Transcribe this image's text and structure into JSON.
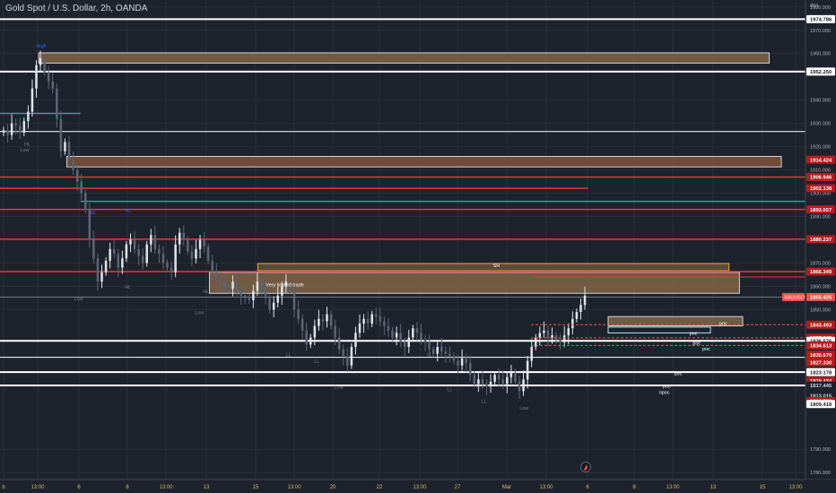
{
  "chart_data": {
    "type": "candlestick",
    "title": "Gold Spot / U.S. Dollar, 2h, OANDA",
    "symbol": "XAUUSD",
    "ylim": [
      1777,
      1983
    ],
    "x_ticks": [
      "b",
      "13:00",
      "6",
      "8",
      "13:00",
      "13",
      "15",
      "13:00",
      "20",
      "22",
      "13:00",
      "27",
      "Mar",
      "13:00",
      "6",
      "8",
      "13:00",
      "13",
      "15",
      "13:00"
    ],
    "y_ticks": [
      {
        "label": "1980.000",
        "value": 1980
      },
      {
        "label": "1970.000",
        "value": 1970
      },
      {
        "label": "1960.000",
        "value": 1960
      },
      {
        "label": "1940.000",
        "value": 1940
      },
      {
        "label": "1930.000",
        "value": 1930
      },
      {
        "label": "1920.000",
        "value": 1920
      },
      {
        "label": "1910.000",
        "value": 1910
      },
      {
        "label": "1900.000",
        "value": 1900
      },
      {
        "label": "1890.000",
        "value": 1890
      },
      {
        "label": "1870.000",
        "value": 1870
      },
      {
        "label": "1860.000",
        "value": 1860
      },
      {
        "label": "1850.000",
        "value": 1850
      },
      {
        "label": "1790.000",
        "value": 1790
      },
      {
        "label": "1780.000",
        "value": 1780
      }
    ],
    "price_labels": [
      {
        "value": 1974.786,
        "text": "1974.786",
        "bg": "#ffffff",
        "fg": "#131722"
      },
      {
        "value": 1952.25,
        "text": "1952.250",
        "bg": "#ffffff",
        "fg": "#131722"
      },
      {
        "value": 1914.424,
        "text": "1914.424",
        "bg": "#b71c1c",
        "fg": "#ffffff"
      },
      {
        "value": 1906.946,
        "text": "1906.946",
        "bg": "#b71c1c",
        "fg": "#ffffff"
      },
      {
        "value": 1902.138,
        "text": "1902.138",
        "bg": "#b71c1c",
        "fg": "#ffffff"
      },
      {
        "value": 1893.057,
        "text": "1893.057",
        "bg": "#b71c1c",
        "fg": "#ffffff"
      },
      {
        "value": 1880.237,
        "text": "1880.237",
        "bg": "#b71c1c",
        "fg": "#ffffff"
      },
      {
        "value": 1866.349,
        "text": "1866.349",
        "bg": "#b71c1c",
        "fg": "#ffffff"
      },
      {
        "value": 1855.425,
        "text": "1855.425",
        "bg": "#ef5350",
        "fg": "#ffffff",
        "tag": "XAUUSD"
      },
      {
        "value": 1843.493,
        "text": "1843.493",
        "bg": "#b71c1c",
        "fg": "#ffffff"
      },
      {
        "value": 1837.94,
        "text": "1837.940",
        "bg": "#b71c1c",
        "fg": "#ffffff"
      },
      {
        "value": 1836.576,
        "text": "1836.576",
        "bg": "#ffffff",
        "fg": "#131722"
      },
      {
        "value": 1834.613,
        "text": "1834.613",
        "bg": "#b71c1c",
        "fg": "#ffffff"
      },
      {
        "value": 1830.67,
        "text": "1830.670",
        "bg": "#b71c1c",
        "fg": "#ffffff"
      },
      {
        "value": 1827.33,
        "text": "1827.330",
        "bg": "#b71c1c",
        "fg": "#ffffff"
      },
      {
        "value": 1823.178,
        "text": "1823.178",
        "bg": "#ffffff",
        "fg": "#131722"
      },
      {
        "value": 1819.434,
        "text": "1819.434",
        "bg": "#b71c1c",
        "fg": "#ffffff"
      },
      {
        "value": 1817.445,
        "text": "1817.445",
        "bg": "#1e222d",
        "fg": "#d1d4dc"
      },
      {
        "value": 1813.015,
        "text": "1813.015",
        "bg": "#1e222d",
        "fg": "#d1d4dc"
      },
      {
        "value": 1810.739,
        "text": "1810.739",
        "bg": "#b71c1c",
        "fg": "#ffffff"
      },
      {
        "value": 1809.418,
        "text": "1809.418",
        "bg": "#ffffff",
        "fg": "#131722"
      }
    ],
    "horizontal_lines": [
      {
        "value": 1974.786,
        "x0": 0.0,
        "x1": 1.0,
        "color": "#ffffff",
        "width": 2
      },
      {
        "value": 1952.25,
        "x0": 0.0,
        "x1": 1.0,
        "color": "#ffffff",
        "width": 2
      },
      {
        "value": 1926.5,
        "x0": 0.0,
        "x1": 1.0,
        "color": "#ffffff",
        "width": 1
      },
      {
        "value": 1906.946,
        "x0": 0.0,
        "x1": 1.0,
        "color": "#e53935",
        "width": 1.5
      },
      {
        "value": 1902.138,
        "x0": 0.0,
        "x1": 0.73,
        "color": "#e53935",
        "width": 1.5
      },
      {
        "value": 1896.5,
        "x0": 0.1,
        "x1": 1.0,
        "color": "#26a69a",
        "width": 1.5
      },
      {
        "value": 1893.057,
        "x0": 0.0,
        "x1": 1.0,
        "color": "#e53935",
        "width": 1.5
      },
      {
        "value": 1880.237,
        "x0": 0.0,
        "x1": 1.0,
        "color": "#e53935",
        "width": 1.5
      },
      {
        "value": 1866.349,
        "x0": 0.0,
        "x1": 1.0,
        "color": "#e53935",
        "width": 1.5
      },
      {
        "value": 1864.0,
        "x0": 0.66,
        "x1": 1.0,
        "color": "#e53935",
        "width": 1
      },
      {
        "value": 1855.425,
        "x0": 0.0,
        "x1": 1.0,
        "color": "#787b86",
        "width": 1
      },
      {
        "value": 1836.576,
        "x0": 0.0,
        "x1": 1.0,
        "color": "#ffffff",
        "width": 2
      },
      {
        "value": 1829.5,
        "x0": 0.0,
        "x1": 1.0,
        "color": "#ffffff",
        "width": 1
      },
      {
        "value": 1823.178,
        "x0": 0.0,
        "x1": 1.0,
        "color": "#ffffff",
        "width": 2
      },
      {
        "value": 1817.445,
        "x0": 0.0,
        "x1": 1.0,
        "color": "#ffffff",
        "width": 2
      },
      {
        "value": 1934.3,
        "x0": 0.0,
        "x1": 0.1,
        "color": "#26a69a",
        "width": 1.5
      }
    ],
    "zones": [
      {
        "y_top": 1960.3,
        "y_bottom": 1955.9,
        "x0": 0.048,
        "x1": 0.955,
        "fill": "#8d6e4a",
        "stroke": "#d1d4dc"
      },
      {
        "y_top": 1915.8,
        "y_bottom": 1911.3,
        "x0": 0.083,
        "x1": 0.97,
        "fill": "#8d5a3a",
        "stroke": "#d1d4dc"
      },
      {
        "y_top": 1869.8,
        "y_bottom": 1866.7,
        "x0": 0.32,
        "x1": 0.905,
        "fill": "#6e5a3c",
        "stroke": "#f9a825"
      },
      {
        "y_top": 1866.0,
        "y_bottom": 1857.0,
        "x0": 0.26,
        "x1": 0.918,
        "fill": "#8d6e4a",
        "stroke": "#d1d4dc"
      },
      {
        "y_top": 1847.0,
        "y_bottom": 1843.0,
        "x0": 0.755,
        "x1": 0.922,
        "fill": "#8d6e4a",
        "stroke": "#d1d4dc"
      },
      {
        "y_top": 1842.5,
        "y_bottom": 1840.0,
        "x0": 0.755,
        "x1": 0.882,
        "fill": "#1e222d",
        "stroke": "#b2ebf2"
      }
    ],
    "annotations": [
      {
        "text": "SR",
        "value": 1868.3,
        "x": 0.612,
        "color": "#ffffff"
      },
      {
        "text": "poc",
        "value": 1843.5,
        "x": 0.893,
        "color": "#ffffff"
      },
      {
        "text": "poc",
        "value": 1839.2,
        "x": 0.856,
        "color": "#ffffff"
      },
      {
        "text": "poc",
        "value": 1835.0,
        "x": 0.86,
        "color": "#ffffff"
      },
      {
        "text": "poc",
        "value": 1832.5,
        "x": 0.872,
        "color": "#ffffff"
      },
      {
        "text": "poc",
        "value": 1821.8,
        "x": 0.837,
        "color": "#ffffff"
      },
      {
        "text": "poc",
        "value": 1816.4,
        "x": 0.823,
        "color": "#ffffff"
      },
      {
        "text": "npoc",
        "value": 1813.8,
        "x": 0.818,
        "color": "#ffffff"
      },
      {
        "text": "Very limited trade",
        "value": 1860.0,
        "x": 0.33,
        "color": "#ffffff"
      },
      {
        "text": "High",
        "value": 1962.5,
        "x": 0.045,
        "color": "#2962ff"
      },
      {
        "text": "HL",
        "value": 1920.5,
        "x": 0.03,
        "color": "#787b86"
      },
      {
        "text": "Low",
        "value": 1918.0,
        "x": 0.025,
        "color": "#787b86"
      },
      {
        "text": "HL",
        "value": 1891.0,
        "x": 0.112,
        "color": "#2962ff"
      },
      {
        "text": "HL",
        "value": 1892.0,
        "x": 0.155,
        "color": "#2962ff"
      },
      {
        "text": "Low",
        "value": 1854.0,
        "x": 0.092,
        "color": "#787b86"
      },
      {
        "text": "HL",
        "value": 1859.0,
        "x": 0.155,
        "color": "#787b86"
      },
      {
        "text": "Low",
        "value": 1848.0,
        "x": 0.242,
        "color": "#787b86"
      },
      {
        "text": "HL",
        "value": 1857.0,
        "x": 0.252,
        "color": "#787b86"
      },
      {
        "text": "LL",
        "value": 1830.0,
        "x": 0.355,
        "color": "#787b86"
      },
      {
        "text": "LL",
        "value": 1827.0,
        "x": 0.39,
        "color": "#787b86"
      },
      {
        "text": "Low",
        "value": 1816.0,
        "x": 0.415,
        "color": "#787b86"
      },
      {
        "text": "LL",
        "value": 1830.0,
        "x": 0.53,
        "color": "#787b86"
      },
      {
        "text": "LL",
        "value": 1815.0,
        "x": 0.555,
        "color": "#787b86"
      },
      {
        "text": "LL",
        "value": 1810.0,
        "x": 0.598,
        "color": "#787b86"
      },
      {
        "text": "Low",
        "value": 1807.0,
        "x": 0.645,
        "color": "#787b86"
      }
    ],
    "series": [
      {
        "name": "XAUUSD",
        "close": [
          1927,
          1925,
          1930,
          1929,
          1926,
          1931,
          1935,
          1945,
          1955,
          1958,
          1952,
          1948,
          1945,
          1932,
          1918,
          1922,
          1914,
          1910,
          1905,
          1900,
          1893,
          1880,
          1872,
          1862,
          1866,
          1871,
          1876,
          1874,
          1868,
          1872,
          1878,
          1880,
          1876,
          1873,
          1870,
          1878,
          1882,
          1876,
          1874,
          1870,
          1868,
          1866,
          1878,
          1883,
          1880,
          1875,
          1872,
          1876,
          1880,
          1877,
          1871,
          1866,
          1864,
          1862,
          1860,
          1859,
          1862,
          1858,
          1856,
          1855,
          1854,
          1858,
          1862,
          1860,
          1855,
          1850,
          1853,
          1856,
          1860,
          1862,
          1858,
          1850,
          1846,
          1841,
          1835,
          1838,
          1843,
          1846,
          1845,
          1848,
          1843,
          1838,
          1833,
          1830,
          1826,
          1834,
          1840,
          1844,
          1846,
          1844,
          1848,
          1847,
          1845,
          1843,
          1841,
          1838,
          1840,
          1836,
          1834,
          1838,
          1842,
          1840,
          1837,
          1836,
          1833,
          1831,
          1834,
          1832,
          1831,
          1830,
          1828,
          1826,
          1829,
          1827,
          1822,
          1818,
          1820,
          1818,
          1817,
          1819,
          1822,
          1820,
          1818,
          1821,
          1823,
          1819,
          1815,
          1820,
          1828,
          1834,
          1838,
          1840,
          1841,
          1838,
          1839,
          1837,
          1836,
          1839,
          1842,
          1846,
          1849,
          1852,
          1856
        ]
      }
    ]
  },
  "bottom_icon": "tradingview-logo-icon"
}
